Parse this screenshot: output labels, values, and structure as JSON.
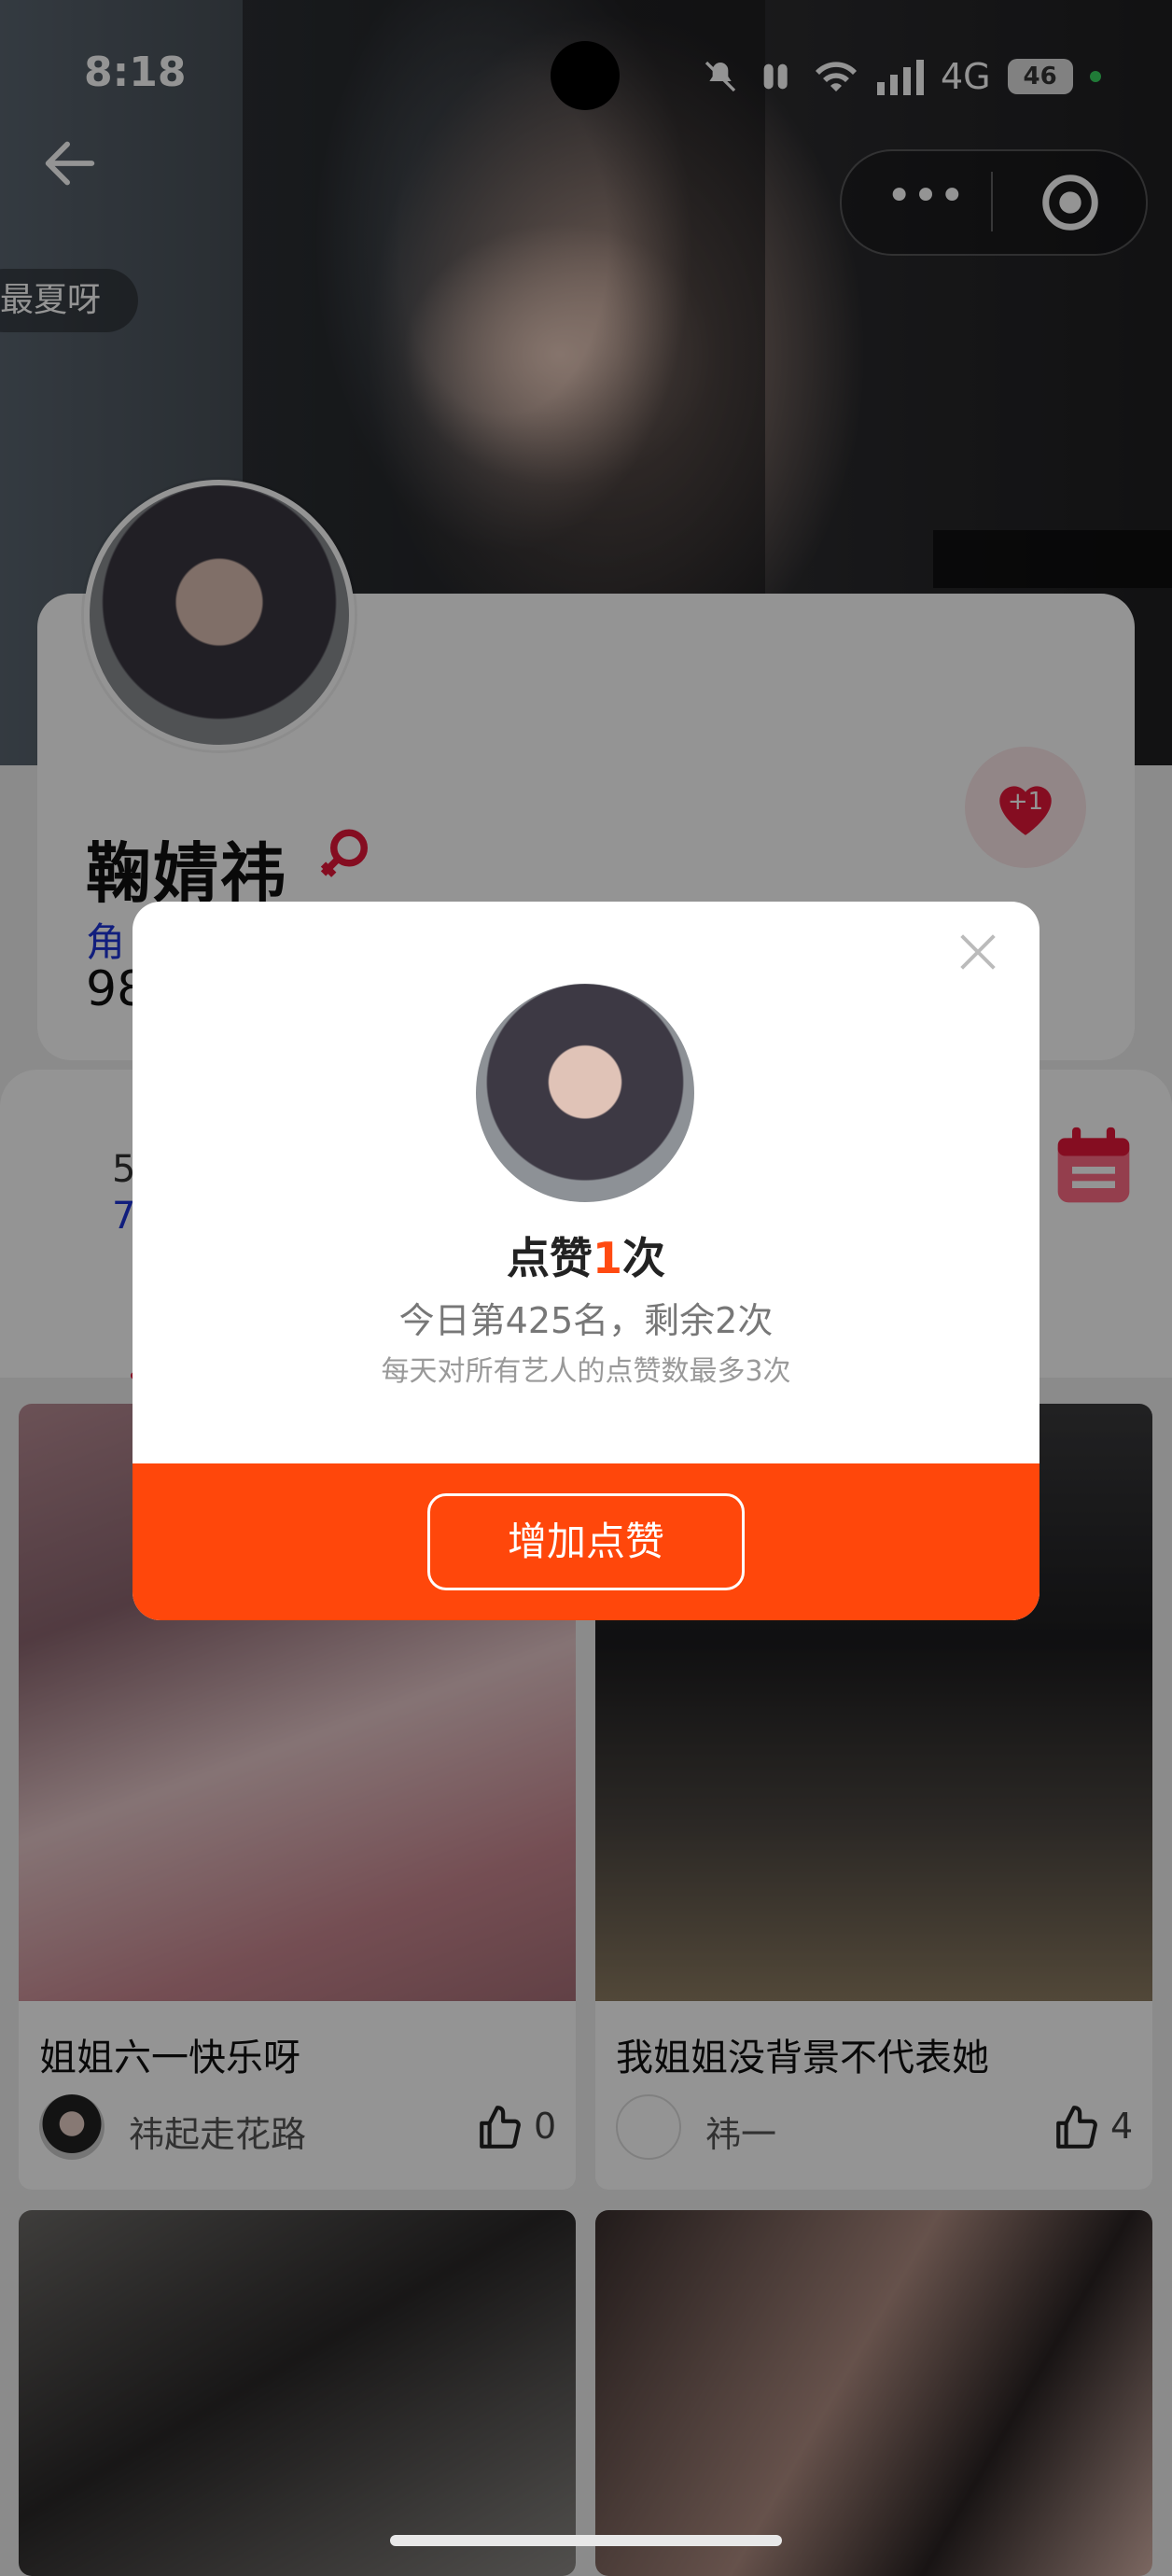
{
  "status_bar": {
    "time": "8:18",
    "network": "4G",
    "battery": "46"
  },
  "header": {
    "tag_pill": "最夏呀",
    "capsule_more": "•••"
  },
  "profile": {
    "name": "鞠婧祎",
    "role_fragment": "角",
    "score_fragment": "98",
    "like_badge": "+1"
  },
  "section": {
    "num1": "5",
    "num2": "7"
  },
  "feed": [
    {
      "title": "姐姐六一快乐呀",
      "user": "祎起走花路",
      "likes": "0"
    },
    {
      "title": "我姐姐没背景不代表她",
      "user": "祎一",
      "likes": "4"
    }
  ],
  "modal": {
    "title_prefix": "点赞",
    "title_num": "1",
    "title_suffix": "次",
    "rank": "今日第425名，剩余2次",
    "note": "每天对所有艺人的点赞数最多3次",
    "button": "增加点赞"
  },
  "colors": {
    "accent": "#ff470b",
    "heart": "#e6183a",
    "link_blue": "#1e35d8"
  }
}
